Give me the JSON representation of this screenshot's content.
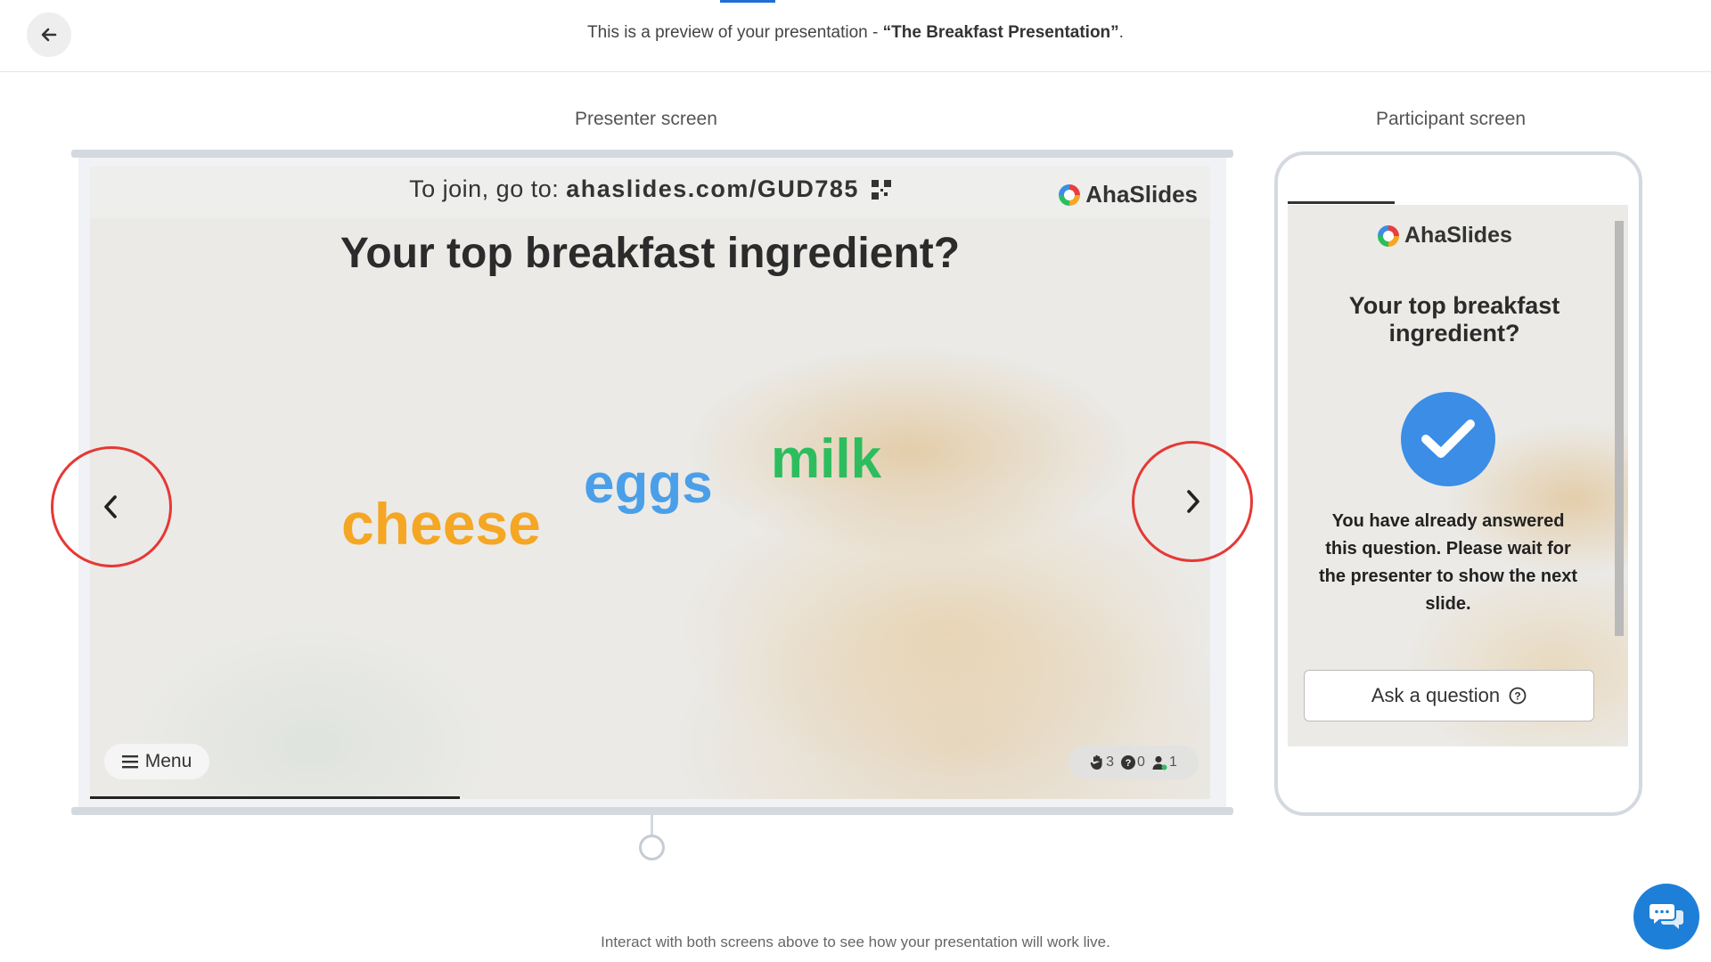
{
  "header": {
    "preview_prefix": "This is a preview of your presentation - ",
    "presentation_title": "“The Breakfast Presentation”",
    "preview_suffix": "."
  },
  "labels": {
    "presenter": "Presenter screen",
    "participant": "Participant screen"
  },
  "slide": {
    "join_prefix": "To join, go to: ",
    "join_url": "ahaslides.com/GUD785",
    "brand": "AhaSlides",
    "question": "Your top breakfast ingredient?",
    "words": [
      {
        "text": "cheese",
        "color": "#f5a623"
      },
      {
        "text": "eggs",
        "color": "#4a9fe8"
      },
      {
        "text": "milk",
        "color": "#2dbd5e"
      }
    ],
    "menu_label": "Menu",
    "stats": {
      "reactions": "3",
      "questions": "0",
      "participants": "1"
    },
    "progress_fraction": 0.33
  },
  "participant": {
    "brand": "AhaSlides",
    "question": "Your top breakfast ingredient?",
    "message": "You have already answered this question. Please wait for the presenter to show the next slide.",
    "ask_label": "Ask a question"
  },
  "footer": {
    "hint": "Interact with both screens above to see how your presentation will work live."
  },
  "colors": {
    "accent": "#1f6fd6",
    "nav_highlight": "#e53935",
    "check": "#3b8de6",
    "chat": "#1e7fd8"
  }
}
